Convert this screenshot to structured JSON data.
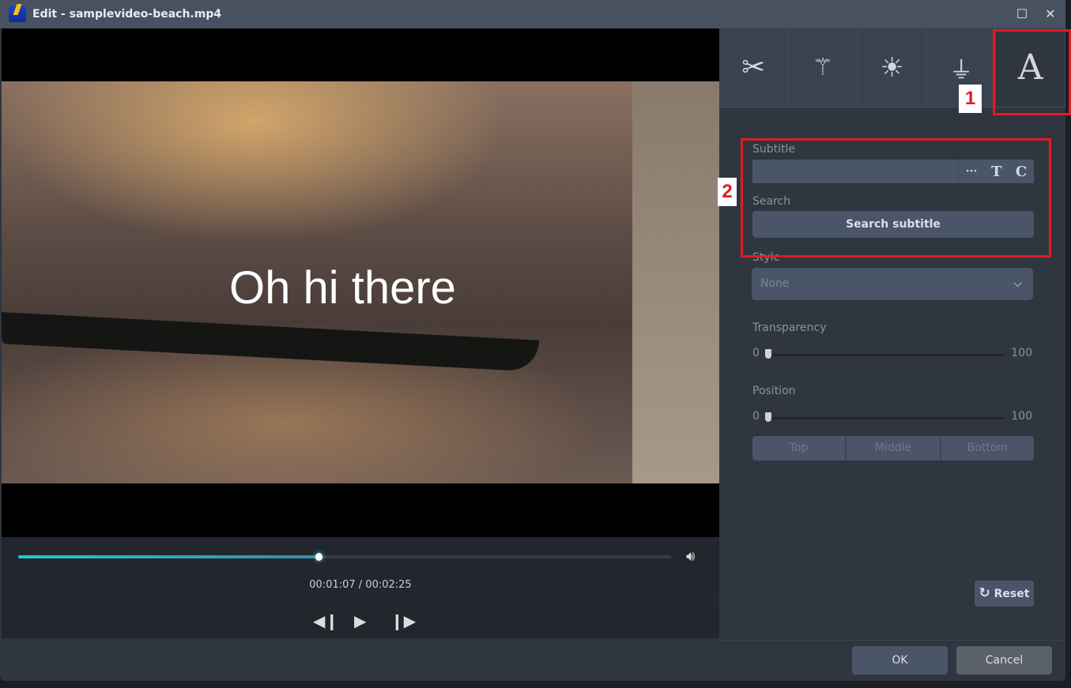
{
  "window": {
    "title": "Edit - samplevideo-beach.mp4",
    "maximize_icon": "maximize-icon",
    "close_icon": "close-icon"
  },
  "video": {
    "subtitle_text": "Oh hi there"
  },
  "player": {
    "current_time": "00:01:07",
    "total_time": "00:02:25",
    "time_display": "00:01:07 / 00:02:25",
    "progress": 0.46
  },
  "tabs": [
    {
      "name": "cut",
      "icon": "scissors-icon"
    },
    {
      "name": "effects",
      "icon": "magic-wand-icon"
    },
    {
      "name": "adjust",
      "icon": "brightness-icon"
    },
    {
      "name": "watermark",
      "icon": "stamp-icon"
    },
    {
      "name": "subtitle",
      "icon": "text-icon",
      "active": true
    }
  ],
  "panel": {
    "subtitle_label": "Subtitle",
    "subtitle_value": "",
    "more": "···",
    "t_btn": "T",
    "c_btn": "C",
    "search_label": "Search",
    "search_button": "Search subtitle",
    "style_label": "Style",
    "style_value": "None",
    "transparency_label": "Transparency",
    "transparency_min": "0",
    "transparency_max": "100",
    "transparency_value": 0,
    "position_label": "Position",
    "position_min": "0",
    "position_max": "100",
    "position_value": 0,
    "position_buttons": [
      "Top",
      "Middle",
      "Bottom"
    ],
    "reset": "Reset"
  },
  "footer": {
    "ok": "OK",
    "cancel": "Cancel"
  },
  "annotations": [
    "1",
    "2"
  ],
  "colors": {
    "accent": "#25c8c8",
    "annotation": "#e01b24"
  }
}
